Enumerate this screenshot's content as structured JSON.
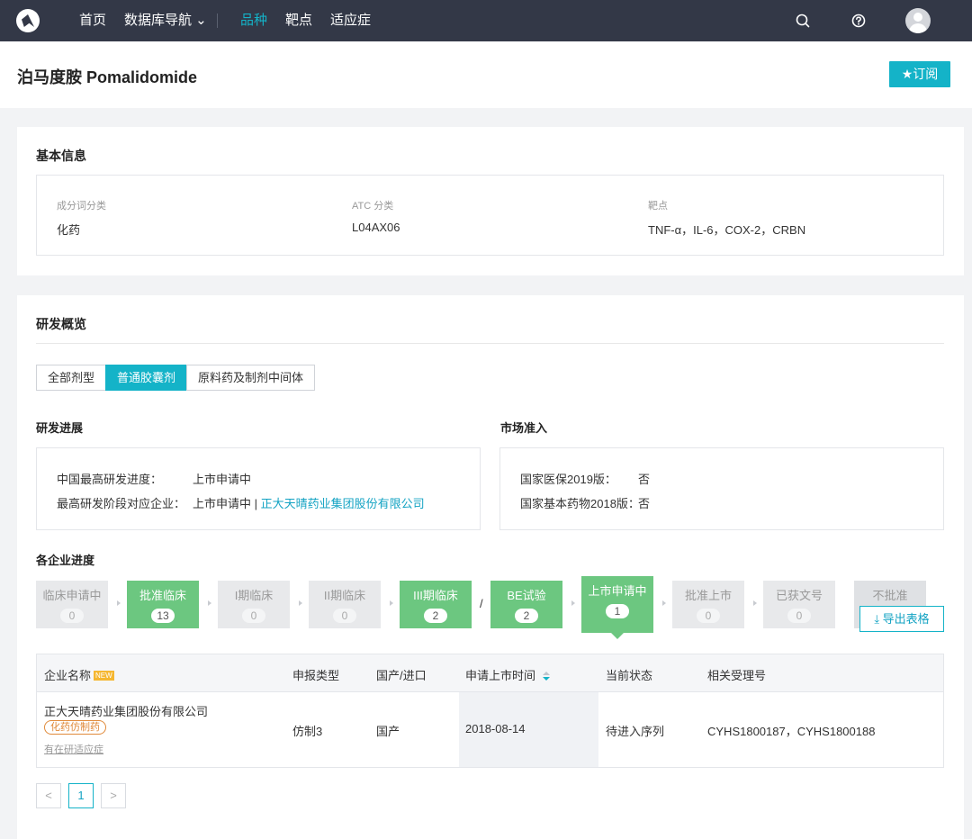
{
  "nav": {
    "items": [
      {
        "label": "首页"
      },
      {
        "label": "数据库导航 ⌄"
      },
      {
        "label": "品种",
        "active": true
      },
      {
        "label": "靶点"
      },
      {
        "label": "适应症"
      }
    ],
    "icons": [
      "search-icon",
      "help-icon",
      "avatar"
    ]
  },
  "page": {
    "title": "泊马度胺 Pomalidomide",
    "subscribe_label": "★订阅"
  },
  "basic_info": {
    "title": "基本信息",
    "fields": [
      {
        "label": "成分词分类",
        "value": "化药"
      },
      {
        "label": "ATC 分类",
        "value": "L04AX06"
      },
      {
        "label": "靶点",
        "value": "TNF-α，IL-6，COX-2，CRBN"
      }
    ]
  },
  "rd": {
    "title": "研发概览",
    "tabs": [
      {
        "label": "全部剂型"
      },
      {
        "label": "普通胶囊剂",
        "active": true
      },
      {
        "label": "原料药及制剂中间体"
      }
    ],
    "progress_title": "研发进展",
    "progress": [
      {
        "label": "中国最高研发进度：",
        "value": "上市申请中"
      },
      {
        "label": "最高研发阶段对应企业：",
        "value": "上市申请中 | ",
        "link": "正大天晴药业集团股份有限公司"
      }
    ],
    "market_title": "市场准入",
    "market": [
      {
        "label": "国家医保2019版：",
        "value": "否"
      },
      {
        "label": "国家基本药物2018版：",
        "value": "否"
      }
    ],
    "stages_title": "各企业进度",
    "stages": [
      {
        "label": "临床申请中",
        "count": "0"
      },
      {
        "label": "批准临床",
        "count": "13"
      },
      {
        "label": "I期临床",
        "count": "0"
      },
      {
        "label": "II期临床",
        "count": "0"
      },
      {
        "label": "III期临床",
        "count": "2"
      },
      {
        "label": "BE试验",
        "count": "2"
      },
      {
        "label": "上市申请中",
        "count": "1"
      },
      {
        "label": "批准上市",
        "count": "0"
      },
      {
        "label": "已获文号",
        "count": "0"
      },
      {
        "label": "不批准",
        "count": ""
      }
    ],
    "stage_separator": "/",
    "export_label": "⤓ 导出表格",
    "table": {
      "headers": [
        "企业名称",
        "申报类型",
        "国产/进口",
        "申请上市时间",
        "当前状态",
        "相关受理号"
      ],
      "new_badge": "NEW",
      "rows": [
        {
          "company": "正大天晴药业集团股份有限公司",
          "tag": "化药仿制药",
          "sub_link": "有在研适应症",
          "type": "仿制3",
          "origin": "国产",
          "date": "2018-08-14",
          "status": "待进入序列",
          "acceptance": "CYHS1800187，CYHS1800188"
        }
      ]
    },
    "pagination": {
      "prev": "<",
      "page": "1",
      "next": ">"
    }
  }
}
